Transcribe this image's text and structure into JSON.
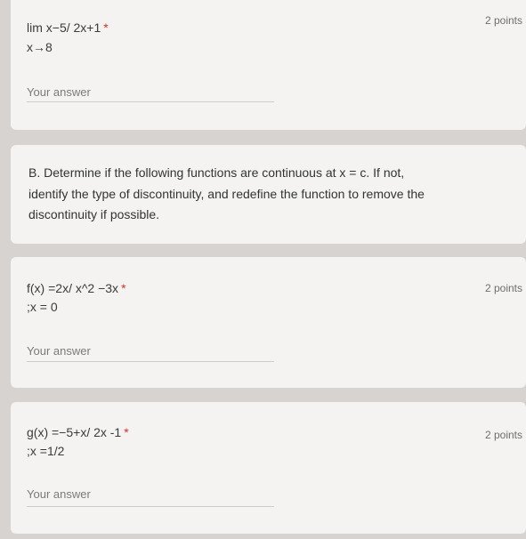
{
  "questions": [
    {
      "line1": "lim x−5/ 2x+1",
      "line2": "x→8",
      "required_mark": "*",
      "points": "2 points",
      "answer_placeholder": "Your answer"
    },
    {
      "line1": "f(x) =2x/ x^2 −3x",
      "line2": ";x = 0",
      "required_mark": "*",
      "points": "2 points",
      "answer_placeholder": "Your answer"
    },
    {
      "line1": "g(x) =−5+x/ 2x -1",
      "line2": ";x =1/2",
      "required_mark": "*",
      "points": "2 points",
      "answer_placeholder": "Your answer"
    }
  ],
  "section": {
    "text": "B. Determine if the following functions are continuous at x = c. If not, identify the type of discontinuity, and redefine the function to remove the discontinuity if possible."
  },
  "colors": {
    "background": "#d6d3d0",
    "card": "#f4f3f1",
    "required": "#d93025"
  }
}
